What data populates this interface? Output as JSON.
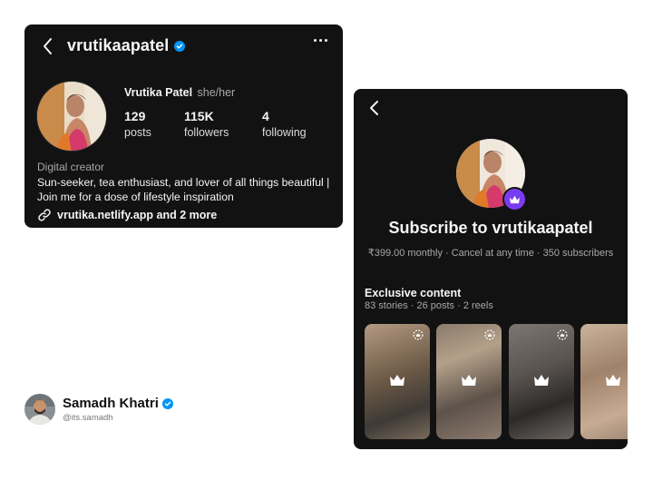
{
  "profile": {
    "username": "vrutikaapatel",
    "name": "Vrutika Patel",
    "pronouns": "she/her",
    "stats": [
      {
        "value": "129",
        "label": "posts"
      },
      {
        "value": "115K",
        "label": "followers"
      },
      {
        "value": "4",
        "label": "following"
      }
    ],
    "category": "Digital creator",
    "bio": "Sun-seeker, tea enthusiast, and lover of all things beautiful | Join me for a dose of lifestyle inspiration",
    "link": "vrutika.netlify.app and 2 more"
  },
  "subscribe": {
    "title": "Subscribe to vrutikaapatel",
    "meta": "₹399.00 monthly · Cancel at any time · 350 subscribers",
    "exclusive_title": "Exclusive content",
    "exclusive_meta": "83 stories · 26 posts · 2 reels"
  },
  "credit": {
    "name": "Samadh Khatri",
    "handle": "@its.samadh"
  },
  "colors": {
    "card_bg": "#121212",
    "verified_blue": "#0095f6",
    "crown_purple": "#7a3cf0"
  },
  "icons": [
    "back-arrow-icon",
    "verified-icon",
    "more-icon",
    "link-icon",
    "crown-icon",
    "story-ring-icon"
  ]
}
